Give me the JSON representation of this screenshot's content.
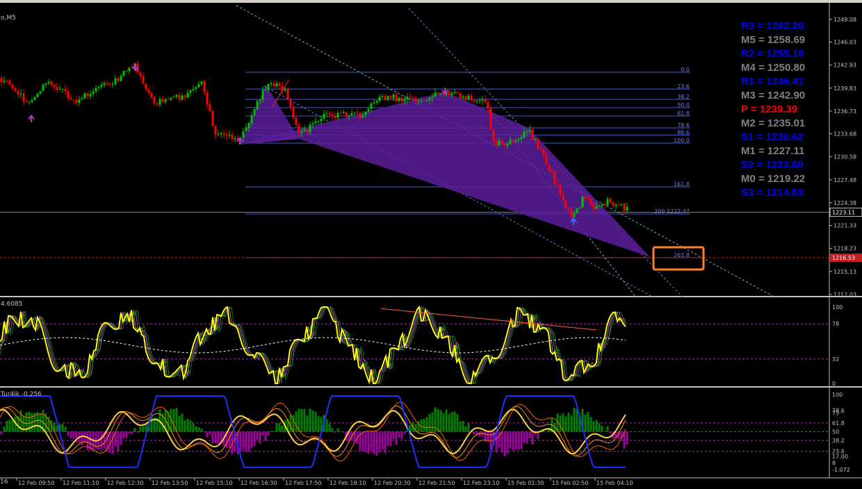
{
  "symbol_label": "o,M5",
  "indicator1_label": "4.6085",
  "indicator2_label": "Tur4ik -0.256",
  "left_cut_label": "16",
  "price_axis": [
    "1249.08",
    "1246.03",
    "1242.93",
    "1239.83",
    "1236.73",
    "1233.68",
    "1230.58",
    "1227.48",
    "1224.38",
    "1221.33",
    "1218.23",
    "1215.13",
    "1212.03"
  ],
  "current_price": "1223.11",
  "target_price": "1216.53",
  "ind1_axis": [
    "100",
    "78",
    "32",
    "0"
  ],
  "ind2_axis": [
    "100",
    "75",
    "78.6",
    "61.8",
    "50",
    "38.2",
    "23.6",
    "17.00",
    "8",
    "-1.072"
  ],
  "time_axis": [
    "12 Feb 09:50",
    "12 Feb 11:10",
    "12 Feb 12:30",
    "12 Feb 13:50",
    "12 Feb 15:10",
    "12 Feb 16:30",
    "12 Feb 17:50",
    "12 Feb 19:10",
    "12 Feb 20:30",
    "12 Feb 21:50",
    "12 Feb 23:10",
    "15 Feb 01:30",
    "15 Feb 02:50",
    "15 Feb 04:10"
  ],
  "pivots": [
    {
      "label": "R3 = 1262.20",
      "color": "blue"
    },
    {
      "label": "M5 = 1258.69",
      "color": "gray"
    },
    {
      "label": "R2 = 1255.18",
      "color": "blue"
    },
    {
      "label": "M4 = 1250.80",
      "color": "gray"
    },
    {
      "label": "R1 = 1246.41",
      "color": "blue"
    },
    {
      "label": "M3 = 1242.90",
      "color": "gray"
    },
    {
      "label": "P  = 1239.39",
      "color": "red"
    },
    {
      "label": "M2 = 1235.01",
      "color": "gray"
    },
    {
      "label": "S1 = 1230.62",
      "color": "blue"
    },
    {
      "label": "M1 = 1227.11",
      "color": "gray"
    },
    {
      "label": "S2 = 1223.60",
      "color": "blue"
    },
    {
      "label": "M0 = 1219.22",
      "color": "gray"
    },
    {
      "label": "S3 = 1214.83",
      "color": "blue"
    }
  ],
  "fib_levels": [
    "0.0",
    "23.6",
    "38.2",
    "50.0",
    "61.8",
    "78.6",
    "88.6",
    "100.0",
    "161.8",
    "200 1222.47",
    "261.8"
  ],
  "colors": {
    "bull": "#00c000",
    "bear": "#ff0000",
    "fib": "#4a5ad0",
    "pattern": "#5a1f9a",
    "highlight": "#ff7f27",
    "osc": "#ffff00"
  },
  "chart_data": {
    "type": "line",
    "title": "",
    "xlabel": "",
    "ylabel": "",
    "ylim": [
      1212.03,
      1250.5
    ],
    "x": [
      "12 Feb 09:50",
      "12 Feb 11:10",
      "12 Feb 12:30",
      "12 Feb 13:50",
      "12 Feb 15:10",
      "12 Feb 16:30",
      "12 Feb 17:50",
      "12 Feb 19:10",
      "12 Feb 20:30",
      "12 Feb 21:50",
      "12 Feb 23:10",
      "15 Feb 01:30",
      "15 Feb 02:50",
      "15 Feb 04:10"
    ],
    "series": [
      {
        "name": "",
        "values": [
          1241.5,
          1238.2,
          1241.8,
          1238.5,
          1237.0,
          1240.2,
          1233.9,
          1236.7,
          1239.0,
          1239.5,
          1237.5,
          1232.4,
          1223.4,
          1223.6
        ]
      }
    ]
  }
}
